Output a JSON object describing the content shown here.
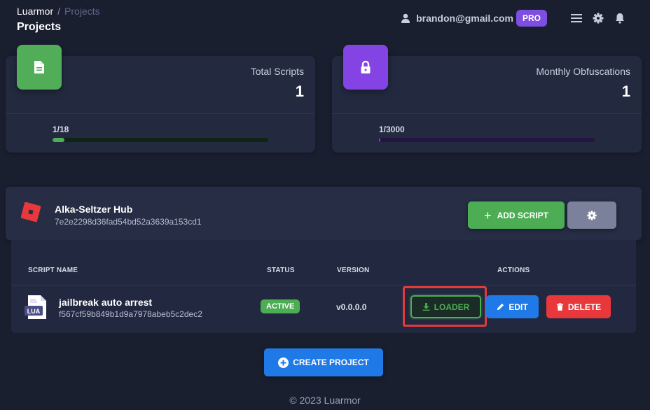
{
  "breadcrumb": {
    "root": "Luarmor",
    "separator": "/",
    "current": "Projects"
  },
  "page_title": "Projects",
  "header": {
    "email": "brandon@gmail.com",
    "badge": "PRO",
    "icons": [
      "user-icon",
      "menu-icon",
      "gear-icon",
      "bell-icon"
    ]
  },
  "stats": [
    {
      "label": "Total Scripts",
      "value": "1",
      "progress_text": "1/18",
      "progress_fraction": 0.0556,
      "icon": "file-icon",
      "color": "#51ad58"
    },
    {
      "label": "Monthly Obfuscations",
      "value": "1",
      "progress_text": "1/3000",
      "progress_fraction": 0.0003,
      "icon": "lock-icon",
      "color": "#8344e3"
    }
  ],
  "project": {
    "name": "Alka-Seltzer Hub",
    "id": "7e2e2298d36fad54bd52a3639a153cd1",
    "add_script_label": "ADD SCRIPT"
  },
  "table": {
    "headers": {
      "name": "SCRIPT NAME",
      "status": "STATUS",
      "version": "VERSION",
      "actions": "ACTIONS"
    },
    "rows": [
      {
        "icon_text": "LUA",
        "name": "jailbreak auto arrest",
        "id": "f567cf59b849b1d9a7978abeb5c2dec2",
        "status": "ACTIVE",
        "version": "v0.0.0.0",
        "loader_label": "LOADER",
        "edit_label": "EDIT",
        "delete_label": "DELETE"
      }
    ]
  },
  "create_project_label": "CREATE PROJECT",
  "footer": "© 2023 Luarmor",
  "colors": {
    "background": "#1a1f30",
    "green": "#4cad54",
    "purple": "#8344e3",
    "blue": "#1f7ae8",
    "red": "#e8383b",
    "highlight": "#e23b3b"
  }
}
